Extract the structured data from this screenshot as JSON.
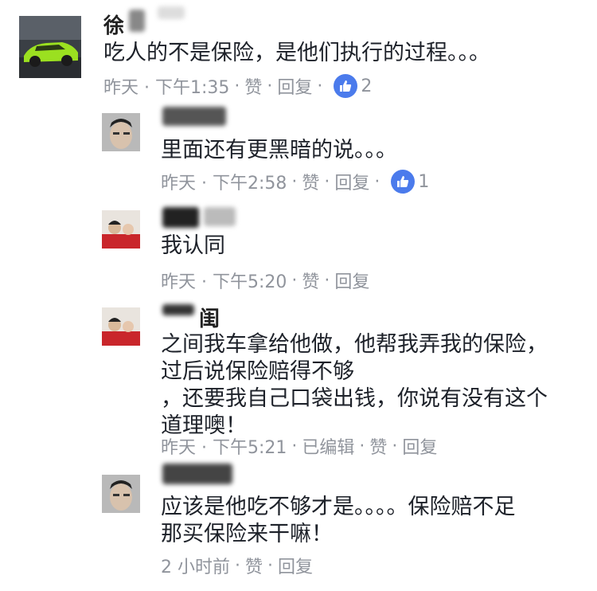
{
  "comments": [
    {
      "name": "徐",
      "text": "吃人的不是保险，是他们执行的过程。。。",
      "time": "昨天 · 下午1:35",
      "like_label": "赞",
      "reply_label": "回复",
      "likes": "2"
    },
    {
      "name": "",
      "text": "里面还有更黑暗的说。。。",
      "time": "昨天 · 下午2:58",
      "like_label": "赞",
      "reply_label": "回复",
      "likes": "1"
    },
    {
      "name": "",
      "text": "我认同",
      "time": "昨天 · 下午5:20",
      "like_label": "赞",
      "reply_label": "回复"
    },
    {
      "name": "闺",
      "text": "之间我车拿给他做，他帮我弄我的保险，\n过后说保险赔得不够\n，还要我自己口袋出钱，你说有没有这个\n道理噢！",
      "time": "昨天 · 下午5:21",
      "edited_label": "已编辑",
      "like_label": "赞",
      "reply_label": "回复"
    },
    {
      "name": "",
      "text": "应该是他吃不够才是。。。。保险赔不足\n那买保险来干嘛！",
      "time": "2 小时前",
      "like_label": "赞",
      "reply_label": "回复"
    }
  ]
}
